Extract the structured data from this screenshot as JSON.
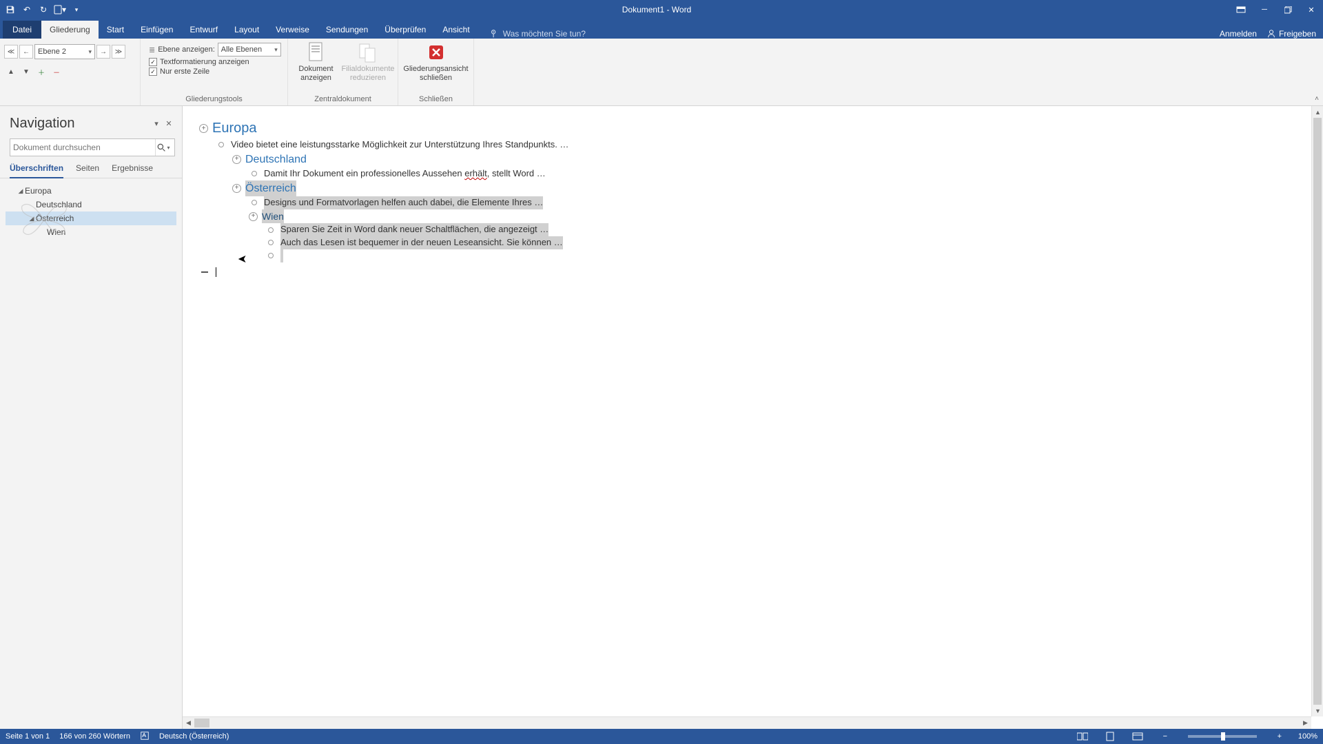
{
  "app_title": "Dokument1 - Word",
  "qat": {
    "save": "💾",
    "undo": "↶",
    "redo": "↷",
    "touch": "📄"
  },
  "tabs": {
    "file": "Datei",
    "outline": "Gliederung",
    "home": "Start",
    "insert": "Einfügen",
    "draw": "Entwurf",
    "layout": "Layout",
    "references": "Verweise",
    "mailings": "Sendungen",
    "review": "Überprüfen",
    "view": "Ansicht"
  },
  "tellme_placeholder": "Was möchten Sie tun?",
  "account": {
    "signin": "Anmelden",
    "share": "Freigeben"
  },
  "ribbon": {
    "level_value": "Ebene 2",
    "show_level_label": "Ebene anzeigen:",
    "show_level_value": "Alle Ebenen",
    "show_formatting": "Textformatierung anzeigen",
    "first_line_only": "Nur erste Zeile",
    "group_outlinetools": "Gliederungstools",
    "doc_show": "Dokument anzeigen",
    "subdocs_collapse": "Filialdokumente reduzieren",
    "group_master": "Zentraldokument",
    "close_outline": "Gliederungsansicht schließen",
    "group_close": "Schließen"
  },
  "nav": {
    "title": "Navigation",
    "search_placeholder": "Dokument durchsuchen",
    "tabs": {
      "headings": "Überschriften",
      "pages": "Seiten",
      "results": "Ergebnisse"
    },
    "tree": {
      "europa": "Europa",
      "deutschland": "Deutschland",
      "oesterreich": "Österreich",
      "wien": "Wien"
    }
  },
  "outline": {
    "h1": "Europa",
    "b1": "Video bietet eine leistungsstarke Möglichkeit zur Unterstützung Ihres Standpunkts. …",
    "h2a": "Deutschland",
    "b2_pre": "Damit Ihr Dokument ein professionelles Aussehen ",
    "b2_err": "erhält",
    "b2_post": ", stellt Word …",
    "h2b": "Österreich",
    "b3": "Designs und Formatvorlagen helfen auch dabei, die Elemente Ihres …",
    "h3": "Wien",
    "b4": "Sparen Sie Zeit in Word dank neuer Schaltflächen, die angezeigt …",
    "b5": "Auch das Lesen ist bequemer in der neuen Leseansicht. Sie können …"
  },
  "status": {
    "page": "Seite 1 von 1",
    "words": "166 von 260 Wörtern",
    "lang": "Deutsch (Österreich)",
    "zoom": "100%"
  }
}
